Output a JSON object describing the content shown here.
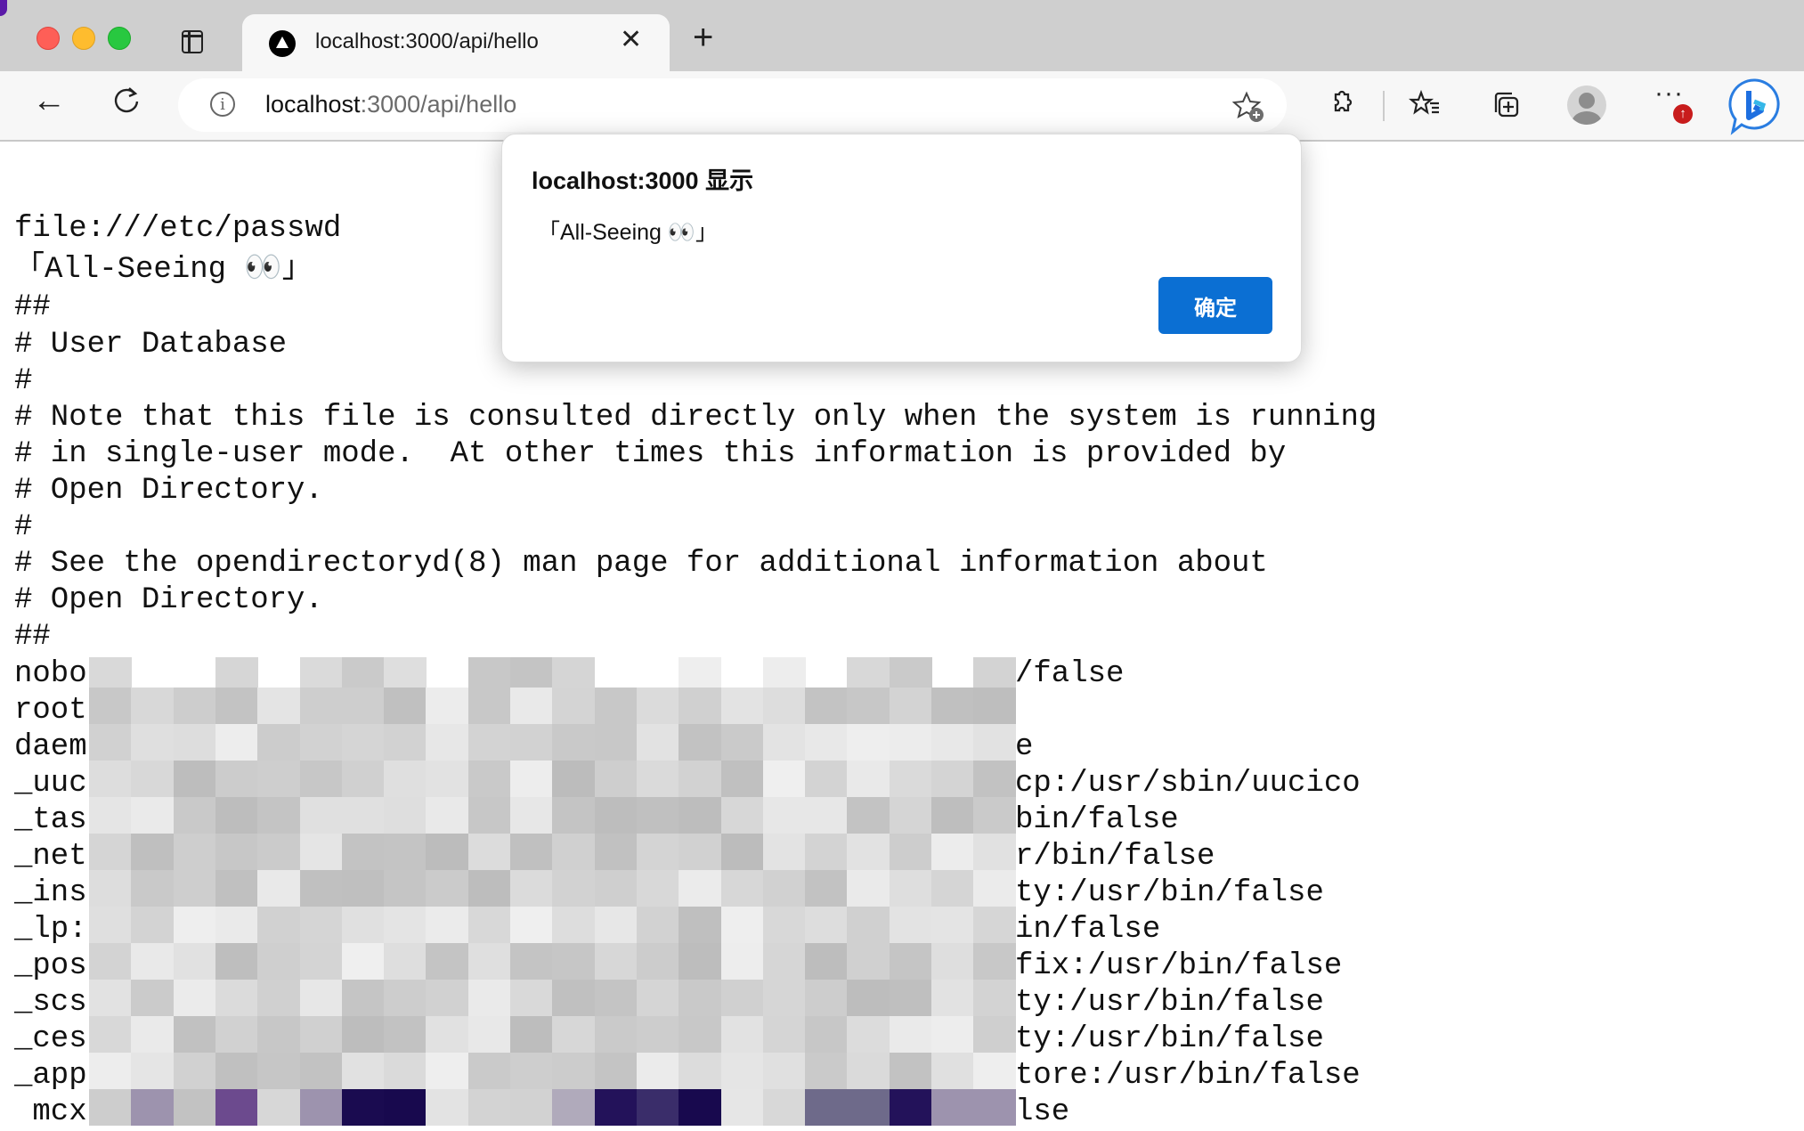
{
  "browser": {
    "tab": {
      "title": "localhost:3000/api/hello",
      "close_label": "✕"
    },
    "new_tab_label": "+",
    "address_bar": {
      "host": "localhost",
      "rest": ":3000/api/hello"
    },
    "icons": {
      "back": "←",
      "info": "i",
      "more": "···",
      "update": "↑"
    }
  },
  "page": {
    "lines": [
      "file:///etc/passwd",
      "「All-Seeing 👀」",
      "##",
      "# User Database",
      "#",
      "# Note that this file is consulted directly only when the system is running",
      "# in single-user mode.  At other times this information is provided by",
      "# Open Directory.",
      "#",
      "# See the opendirectoryd(8) man page for additional information about",
      "# Open Directory.",
      "##"
    ],
    "redacted_lines": [
      {
        "left": "nobo",
        "right": "/false"
      },
      {
        "left": "root",
        "right": ""
      },
      {
        "left": "daem",
        "right": "e"
      },
      {
        "left": "_uuc",
        "right": "cp:/usr/sbin/uucico"
      },
      {
        "left": "_tas",
        "right": "bin/false"
      },
      {
        "left": "_net",
        "right": "r/bin/false"
      },
      {
        "left": "_ins",
        "right": "ty:/usr/bin/false"
      },
      {
        "left": "_lp:",
        "right": "in/false"
      },
      {
        "left": "_pos",
        "right": "fix:/usr/bin/false"
      },
      {
        "left": "_scs",
        "right": "ty:/usr/bin/false"
      },
      {
        "left": "_ces",
        "right": "ty:/usr/bin/false"
      },
      {
        "left": "_app",
        "right": "tore:/usr/bin/false"
      },
      {
        "left": " mcx",
        "right": "lse"
      }
    ]
  },
  "dialog": {
    "title": "localhost:3000 显示",
    "message": "「All-Seeing 👀」",
    "ok_label": "确定"
  },
  "colors": {
    "accent": "#0b6fd3",
    "tabbar": "#cfcfcf",
    "toolbar": "#f7f7f7"
  }
}
